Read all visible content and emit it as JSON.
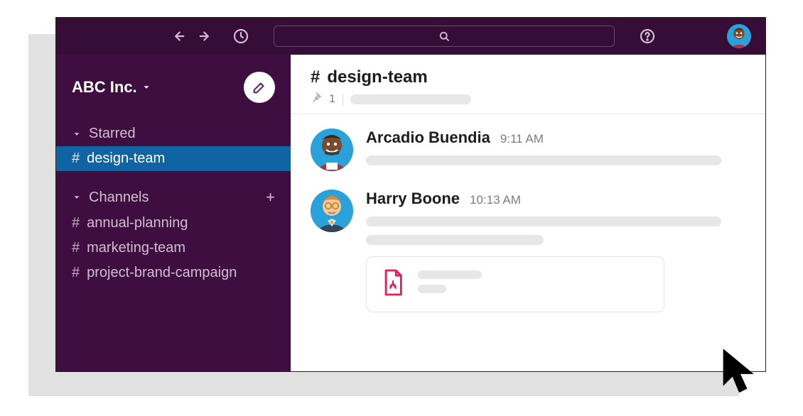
{
  "workspace": {
    "name": "ABC Inc."
  },
  "sidebar": {
    "sections": [
      {
        "label": "Starred",
        "has_add": false,
        "items": [
          {
            "label": "design-team",
            "active": true
          }
        ]
      },
      {
        "label": "Channels",
        "has_add": true,
        "items": [
          {
            "label": "annual-planning",
            "active": false
          },
          {
            "label": "marketing-team",
            "active": false
          },
          {
            "label": "project-brand-campaign",
            "active": false
          }
        ]
      }
    ]
  },
  "channel": {
    "hash": "#",
    "name": "design-team",
    "pin_count": "1"
  },
  "messages": [
    {
      "author": "Arcadio Buendia",
      "time": "9:11 AM",
      "avatar": "arcadio"
    },
    {
      "author": "Harry Boone",
      "time": "10:13 AM",
      "avatar": "harry",
      "attachment": {
        "type": "pdf"
      }
    }
  ],
  "icons": {
    "compose": "compose",
    "search": "search",
    "help": "help",
    "back": "back",
    "forward": "forward",
    "history": "history"
  }
}
